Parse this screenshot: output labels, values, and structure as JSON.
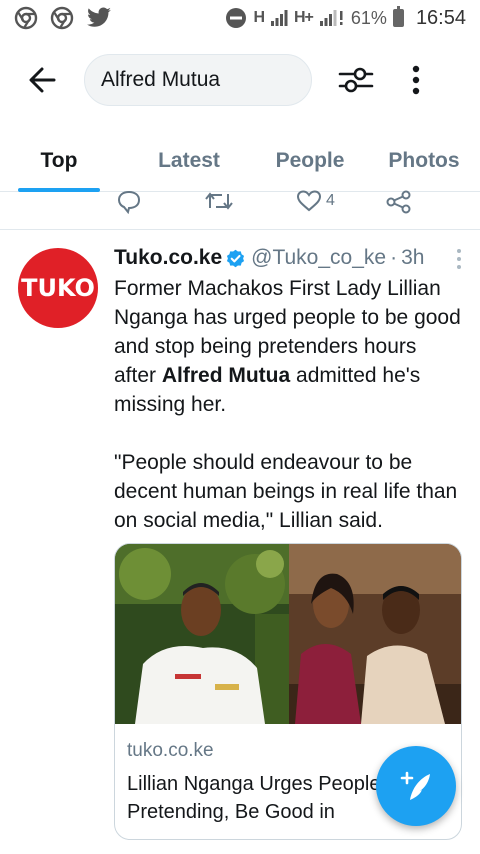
{
  "status_bar": {
    "network_1": "H",
    "network_2": "H+",
    "battery_percent": "61%",
    "time": "16:54",
    "icons": [
      "chrome-icon",
      "chrome-icon",
      "twitter-icon",
      "do-not-disturb-icon",
      "signal-icon",
      "signal-icon",
      "battery-icon"
    ]
  },
  "search": {
    "query": "Alfred Mutua",
    "icons": [
      "back-arrow-icon",
      "filter-icon",
      "more-vertical-icon"
    ]
  },
  "tabs": [
    {
      "label": "Top",
      "active": true
    },
    {
      "label": "Latest",
      "active": false
    },
    {
      "label": "People",
      "active": false
    },
    {
      "label": "Photos",
      "active": false
    }
  ],
  "previous_tweet": {
    "like_count": "4",
    "icons": [
      "reply-icon",
      "retweet-icon",
      "like-icon",
      "share-icon"
    ]
  },
  "tweet": {
    "avatar_text": "TUKO",
    "author_name": "Tuko.co.ke",
    "handle": "@Tuko_co_ke",
    "separator": "·",
    "time": "3h",
    "text_part1": "Former Machakos First Lady Lillian Nganga has urged people to be good and stop being pretenders hours after ",
    "text_bold": "Alfred Mutua",
    "text_part2": " admitted he's missing her.",
    "text_quote": "\"People should endeavour to be decent human beings in real life than on social media,\" Lillian said.",
    "card": {
      "domain": "tuko.co.ke",
      "title": "Lillian Nganga Urges People to Stop Pretending, Be Good in"
    },
    "accent_color": "#1da1f2",
    "brand_color": "#e02027"
  },
  "fab": {
    "icon": "compose-tweet-icon"
  }
}
